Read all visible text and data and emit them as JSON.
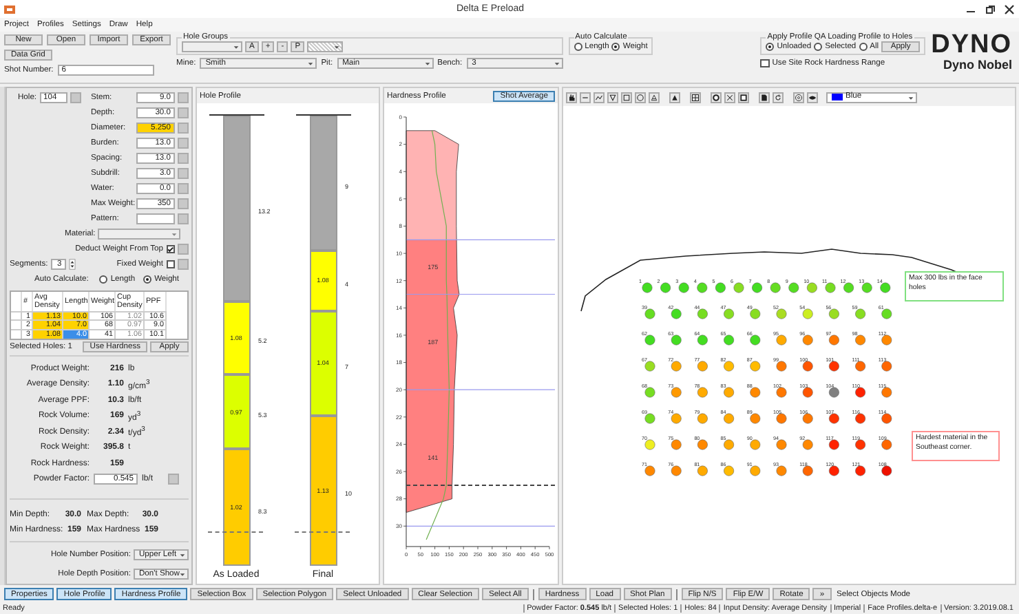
{
  "window": {
    "title": "Delta E Preload"
  },
  "menu": [
    "Project",
    "Profiles",
    "Settings",
    "Draw",
    "Help"
  ],
  "toolbar": {
    "buttons": [
      "New",
      "Open",
      "Import",
      "Export"
    ],
    "data_grid": "Data Grid",
    "shot_number": {
      "label": "Shot Number:",
      "value": "6"
    },
    "hole_groups": {
      "label": "Hole Groups",
      "buttons": [
        "A",
        "+",
        "-",
        "P"
      ]
    },
    "auto_calculate": {
      "label": "Auto Calculate",
      "options": [
        {
          "label": "Length",
          "selected": false
        },
        {
          "label": "Weight",
          "selected": true
        }
      ]
    },
    "mine": {
      "label": "Mine:",
      "value": "Smith"
    },
    "pit": {
      "label": "Pit:",
      "value": "Main"
    },
    "bench": {
      "label": "Bench:",
      "value": "3"
    },
    "apply_profile": {
      "label": "Apply Profile QA Loading Profile to Holes",
      "options": [
        {
          "label": "Unloaded",
          "selected": true
        },
        {
          "label": "Selected",
          "selected": false
        },
        {
          "label": "All",
          "selected": false
        }
      ],
      "button": "Apply"
    },
    "site_hardness": {
      "label": "Use Site Rock Hardness Range",
      "checked": false
    },
    "logo": {
      "title": "DYNO",
      "subtitle": "Dyno Nobel"
    }
  },
  "properties": {
    "hole": {
      "label": "Hole:",
      "value": "104"
    },
    "fields": [
      {
        "label": "Stem:",
        "value": "9.0",
        "highlight": false
      },
      {
        "label": "Depth:",
        "value": "30.0",
        "highlight": false
      },
      {
        "label": "Diameter:",
        "value": "5.250",
        "highlight": true
      },
      {
        "label": "Burden:",
        "value": "13.0",
        "highlight": false
      },
      {
        "label": "Spacing:",
        "value": "13.0",
        "highlight": false
      },
      {
        "label": "Subdrill:",
        "value": "3.0",
        "highlight": false
      },
      {
        "label": "Water:",
        "value": "0.0",
        "highlight": false
      },
      {
        "label": "Max Weight:",
        "value": "350",
        "highlight": false
      },
      {
        "label": "Pattern:",
        "highlight": false
      }
    ],
    "material": {
      "label": "Material:"
    },
    "deduct": {
      "label": "Deduct Weight From Top",
      "checked": true
    },
    "segments": {
      "label": "Segments:",
      "value": "3"
    },
    "fixed_weight": {
      "label": "Fixed Weight",
      "checked": false
    },
    "auto_calculate": {
      "label": "Auto Calculate:",
      "options": [
        {
          "label": "Length",
          "selected": false
        },
        {
          "label": "Weight",
          "selected": true
        }
      ]
    },
    "segment_table": {
      "columns": [
        "#",
        "Avg Density",
        "Length",
        "Weight",
        "Cup Density",
        "PPF"
      ],
      "rows": [
        {
          "cells": [
            "1",
            "1.13",
            "10.0",
            "106",
            "1.02",
            "10.6"
          ],
          "selected": false
        },
        {
          "cells": [
            "2",
            "1.04",
            "7.0",
            "68",
            "0.97",
            "9.0"
          ],
          "selected": false
        },
        {
          "cells": [
            "3",
            "1.08",
            "4.0",
            "41",
            "1.06",
            "10.1"
          ],
          "selected": true
        }
      ]
    },
    "selected_holes": "Selected Holes: 1",
    "table_buttons": [
      "Use Hardness",
      "Apply"
    ],
    "stats": [
      {
        "label": "Product Weight:",
        "value": "216",
        "unit": "lb"
      },
      {
        "label": "Average Density:",
        "value": "1.10",
        "unit": "g/cm$^{3}$"
      },
      {
        "label": "Average PPF:",
        "value": "10.3",
        "unit": "lb/ft"
      },
      {
        "label": "Rock Volume:",
        "value": "169",
        "unit": "yd$^{3}$"
      },
      {
        "label": "Rock Density:",
        "value": "2.34",
        "unit": "t/yd$^{3}$"
      },
      {
        "label": "Rock Weight:",
        "value": "395.8",
        "unit": "t"
      },
      {
        "label": "Rock Hardness:",
        "value": "159"
      }
    ],
    "powder_factor": {
      "label": "Powder Factor:",
      "value": "0.545",
      "unit": "lb/t"
    },
    "ranges": [
      {
        "label": "Min Depth:",
        "value": "30.0"
      },
      {
        "label": "Max Depth:",
        "value": "30.0"
      },
      {
        "label": "Min Hardness:",
        "value": "159"
      },
      {
        "label": "Max Hardness",
        "value": "159"
      }
    ],
    "positions": [
      {
        "label": "Hole Number Position:",
        "value": "Upper Left"
      },
      {
        "label": "Hole Depth Position:",
        "value": "Don't Show"
      }
    ]
  },
  "hole_profile": {
    "title": "Hole Profile",
    "columns": [
      {
        "label": "As Loaded",
        "segments": [
          {
            "kind": "stem",
            "length": "13.2"
          },
          {
            "kind": "product",
            "color": "#ffff00",
            "density": "1.08",
            "length": "5.2"
          },
          {
            "kind": "product",
            "color": "#dcff00",
            "density": "0.97",
            "length": "5.3"
          },
          {
            "kind": "product",
            "color": "#ffcc00",
            "density": "1.02",
            "length": "8.3"
          }
        ]
      },
      {
        "label": "Final",
        "segments": [
          {
            "kind": "stem",
            "length": "9"
          },
          {
            "kind": "product",
            "color": "#ffff00",
            "density": "1.08",
            "length": "4"
          },
          {
            "kind": "product",
            "color": "#dcff00",
            "density": "1.04",
            "length": "7"
          },
          {
            "kind": "product",
            "color": "#ffcc00",
            "density": "1.13",
            "length": "10"
          }
        ]
      }
    ]
  },
  "hardness_profile": {
    "title": "Hardness Profile",
    "button": "Shot Average",
    "chart_data": {
      "type": "area",
      "orientation": "horizontal",
      "x": [
        1,
        2,
        4,
        8,
        12,
        13,
        14,
        16,
        20,
        24,
        27,
        28,
        29,
        30,
        31
      ],
      "series": [
        {
          "color": "#ff8080",
          "values": [
            100,
            183,
            175,
            175,
            178,
            185,
            165,
            178,
            168,
            165,
            160,
            160,
            0,
            null,
            null
          ]
        },
        {
          "type": "line",
          "color": "#70b050",
          "values": [
            90,
            100,
            105,
            140,
            140,
            142,
            143,
            145,
            150,
            145,
            140,
            130,
            110,
            90,
            70
          ]
        }
      ],
      "xlim": [
        0,
        500
      ],
      "ylim": [
        31.5,
        0
      ],
      "xticks": [
        0,
        50,
        100,
        150,
        200,
        250,
        300,
        350,
        400,
        450,
        500
      ],
      "yticks": [
        0,
        2,
        4,
        6,
        8,
        10,
        12,
        14,
        16,
        18,
        20,
        22,
        24,
        26,
        28,
        30
      ],
      "annotations": [
        "175",
        "187",
        "141"
      ]
    }
  },
  "canvas": {
    "color_select": {
      "value": "Blue",
      "color": "#0000ff"
    },
    "notes": [
      {
        "text": "Max 300 lbs in the face holes",
        "color": "#80e080"
      },
      {
        "text": "Hardest material in the Southeast corner.",
        "color": "#ff9090"
      }
    ],
    "hole_rows": [
      {
        "holes": [
          {
            "number": "1",
            "color": "#44dd22"
          },
          {
            "number": "2",
            "color": "#44dd22"
          },
          {
            "number": "3",
            "color": "#44dd22"
          },
          {
            "number": "4",
            "color": "#55dd22"
          },
          {
            "number": "5",
            "color": "#44dd22"
          },
          {
            "number": "6",
            "color": "#88dd22"
          },
          {
            "number": "7",
            "color": "#44dd22"
          },
          {
            "number": "8",
            "color": "#66dd22"
          },
          {
            "number": "9",
            "color": "#55dd22"
          },
          {
            "number": "10",
            "color": "#99dd22"
          },
          {
            "number": "11",
            "color": "#77dd22"
          },
          {
            "number": "12",
            "color": "#55dd22"
          },
          {
            "number": "13",
            "color": "#55dd22"
          },
          {
            "number": "14",
            "color": "#44dd22"
          }
        ]
      },
      {
        "holes": [
          {
            "number": "39",
            "color": "#66dd22"
          },
          {
            "number": "42",
            "color": "#44dd22"
          },
          {
            "number": "44",
            "color": "#77dd22"
          },
          {
            "number": "47",
            "color": "#88dd22"
          },
          {
            "number": "49",
            "color": "#88dd22"
          },
          {
            "number": "52",
            "color": "#aadd22"
          },
          {
            "number": "54",
            "color": "#ccee22"
          },
          {
            "number": "56",
            "color": "#99dd22"
          },
          {
            "number": "59",
            "color": "#88dd22"
          },
          {
            "number": "61",
            "color": "#66dd22"
          }
        ]
      },
      {
        "holes": [
          {
            "number": "62",
            "color": "#44dd22"
          },
          {
            "number": "63",
            "color": "#44dd22"
          },
          {
            "number": "64",
            "color": "#44dd22"
          },
          {
            "number": "65",
            "color": "#44dd22"
          },
          {
            "number": "66",
            "color": "#44dd22"
          },
          {
            "number": "95",
            "color": "#ffaa00"
          },
          {
            "number": "96",
            "color": "#ff8800"
          },
          {
            "number": "97",
            "color": "#ff7700"
          },
          {
            "number": "98",
            "color": "#ff8800"
          },
          {
            "number": "112",
            "color": "#ff8800"
          }
        ]
      },
      {
        "holes": [
          {
            "number": "67",
            "color": "#99dd22"
          },
          {
            "number": "72",
            "color": "#ffaa00"
          },
          {
            "number": "77",
            "color": "#ffaa00"
          },
          {
            "number": "82",
            "color": "#ffbb00"
          },
          {
            "number": "87",
            "color": "#ffbb00"
          },
          {
            "number": "99",
            "color": "#ff7700"
          },
          {
            "number": "100",
            "color": "#ff5500"
          },
          {
            "number": "101",
            "color": "#ff3300"
          },
          {
            "number": "111",
            "color": "#ff6600"
          },
          {
            "number": "113",
            "color": "#ff6600"
          }
        ]
      },
      {
        "holes": [
          {
            "number": "68",
            "color": "#77dd22"
          },
          {
            "number": "73",
            "color": "#ff9900"
          },
          {
            "number": "78",
            "color": "#ffaa00"
          },
          {
            "number": "83",
            "color": "#ffaa00"
          },
          {
            "number": "88",
            "color": "#ff8800"
          },
          {
            "number": "102",
            "color": "#ff7700"
          },
          {
            "number": "103",
            "color": "#ff5500"
          },
          {
            "number": "104",
            "color": "#808080"
          },
          {
            "number": "110",
            "color": "#ff2200"
          },
          {
            "number": "115",
            "color": "#ff7700"
          }
        ]
      },
      {
        "holes": [
          {
            "number": "69",
            "color": "#77dd22"
          },
          {
            "number": "74",
            "color": "#ffaa00"
          },
          {
            "number": "79",
            "color": "#ffaa00"
          },
          {
            "number": "84",
            "color": "#ffaa00"
          },
          {
            "number": "89",
            "color": "#ff8800"
          },
          {
            "number": "105",
            "color": "#ff7700"
          },
          {
            "number": "106",
            "color": "#ff7700"
          },
          {
            "number": "107",
            "color": "#ff3300"
          },
          {
            "number": "116",
            "color": "#ff3300"
          },
          {
            "number": "114",
            "color": "#ff5500"
          }
        ]
      },
      {
        "holes": [
          {
            "number": "70",
            "color": "#eeee22"
          },
          {
            "number": "75",
            "color": "#ff8800"
          },
          {
            "number": "80",
            "color": "#ff8800"
          },
          {
            "number": "85",
            "color": "#ffaa00"
          },
          {
            "number": "90",
            "color": "#ffaa00"
          },
          {
            "number": "94",
            "color": "#ff8800"
          },
          {
            "number": "92",
            "color": "#ff8800"
          },
          {
            "number": "117",
            "color": "#ff2200"
          },
          {
            "number": "119",
            "color": "#ff3300"
          },
          {
            "number": "109",
            "color": "#ff6600"
          }
        ]
      },
      {
        "holes": [
          {
            "number": "71",
            "color": "#ff8800"
          },
          {
            "number": "76",
            "color": "#ff8800"
          },
          {
            "number": "81",
            "color": "#ffaa00"
          },
          {
            "number": "86",
            "color": "#ffbb00"
          },
          {
            "number": "91",
            "color": "#ffaa00"
          },
          {
            "number": "93",
            "color": "#ff8800"
          },
          {
            "number": "118",
            "color": "#ff6600"
          },
          {
            "number": "120",
            "color": "#ff2200"
          },
          {
            "number": "121",
            "color": "#ff2200"
          },
          {
            "number": "108",
            "color": "#ee1100"
          }
        ]
      }
    ]
  },
  "bottom_buttons": [
    {
      "label": "Properties",
      "selected": true,
      "separator_before": false
    },
    {
      "label": "Hole Profile",
      "selected": true,
      "separator_before": false
    },
    {
      "label": "Hardness Profile",
      "selected": true,
      "separator_before": false
    },
    {
      "label": "Selection Box",
      "selected": false,
      "separator_before": false
    },
    {
      "label": "Selection Polygon",
      "selected": false,
      "separator_before": false
    },
    {
      "label": "Select Unloaded",
      "selected": false,
      "separator_before": false
    },
    {
      "label": "Clear Selection",
      "selected": false,
      "separator_before": false
    },
    {
      "label": "Select All",
      "selected": false,
      "separator_before": false
    },
    {
      "label": "Hardness",
      "selected": false,
      "separator_before": true
    },
    {
      "label": "Load",
      "selected": false,
      "separator_before": false
    },
    {
      "label": "Shot Plan",
      "selected": false,
      "separator_before": false
    },
    {
      "label": "Flip N/S",
      "selected": false,
      "separator_before": true
    },
    {
      "label": "Flip E/W",
      "selected": false,
      "separator_before": false
    },
    {
      "label": "Rotate",
      "selected": false,
      "separator_before": false
    },
    {
      "label": "»",
      "selected": false,
      "separator_before": false
    }
  ],
  "mode": "Select Objects Mode",
  "status_bar": {
    "left": "Ready",
    "items": [
      "Powder Factor: **0.545** lb/t",
      "Selected Holes: 1",
      "Holes: 84",
      "Input Density: Average Density",
      "Imperial",
      "Face Profiles.delta-e",
      "Version: 3.2019.08.1"
    ]
  }
}
